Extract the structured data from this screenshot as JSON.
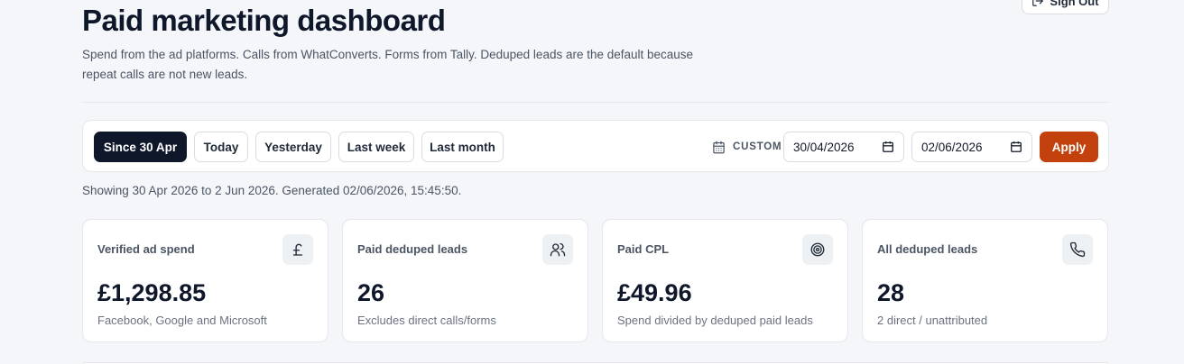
{
  "header": {
    "title": "Paid marketing dashboard",
    "subtitle": "Spend from the ad platforms. Calls from WhatConverts. Forms from Tally. Deduped leads are the default because repeat calls are not new leads.",
    "signout_label": "Sign Out"
  },
  "toolbar": {
    "ranges": [
      {
        "label": "Since 30 Apr",
        "active": true
      },
      {
        "label": "Today",
        "active": false
      },
      {
        "label": "Yesterday",
        "active": false
      },
      {
        "label": "Last week",
        "active": false
      },
      {
        "label": "Last month",
        "active": false
      }
    ],
    "custom_label": "CUSTOM",
    "start_date": "30/04/2026",
    "end_date": "02/06/2026",
    "apply_label": "Apply"
  },
  "status": {
    "showing": "Showing 30 Apr 2026 to 2 Jun 2026. Generated 02/06/2026, 15:45:50."
  },
  "cards": [
    {
      "label": "Verified ad spend",
      "value": "£1,298.85",
      "note": "Facebook, Google and Microsoft",
      "icon": "pound-icon"
    },
    {
      "label": "Paid deduped leads",
      "value": "26",
      "note": "Excludes direct calls/forms",
      "icon": "users-icon"
    },
    {
      "label": "Paid CPL",
      "value": "£49.96",
      "note": "Spend divided by deduped paid leads",
      "icon": "target-icon"
    },
    {
      "label": "All deduped leads",
      "value": "28",
      "note": "2 direct / unattributed",
      "icon": "phone-icon"
    }
  ],
  "colors": {
    "accent": "#c2410c",
    "active_range": "#0f172a",
    "background": "#f4f6f9"
  }
}
